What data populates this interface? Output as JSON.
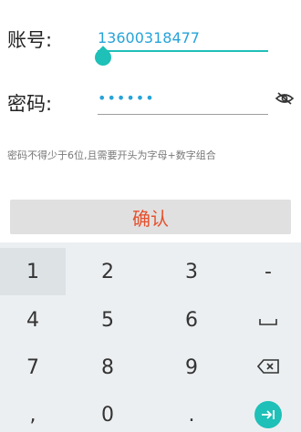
{
  "form": {
    "account_label": "账号:",
    "account_value": "13600318477",
    "password_label": "密码:",
    "password_value": "••••••",
    "hint": "密码不得少于6位,且需要开头为字母+数字组合",
    "confirm_label": "确认"
  },
  "keyboard": {
    "keys": [
      "1",
      "2",
      "3",
      "-",
      "4",
      "5",
      "6",
      "space",
      "7",
      "8",
      "9",
      "backspace",
      ",",
      "0",
      ".",
      "enter"
    ]
  },
  "colors": {
    "accent": "#1ec0b8",
    "input_text": "#26a3d8",
    "confirm_text": "#e6502c"
  }
}
